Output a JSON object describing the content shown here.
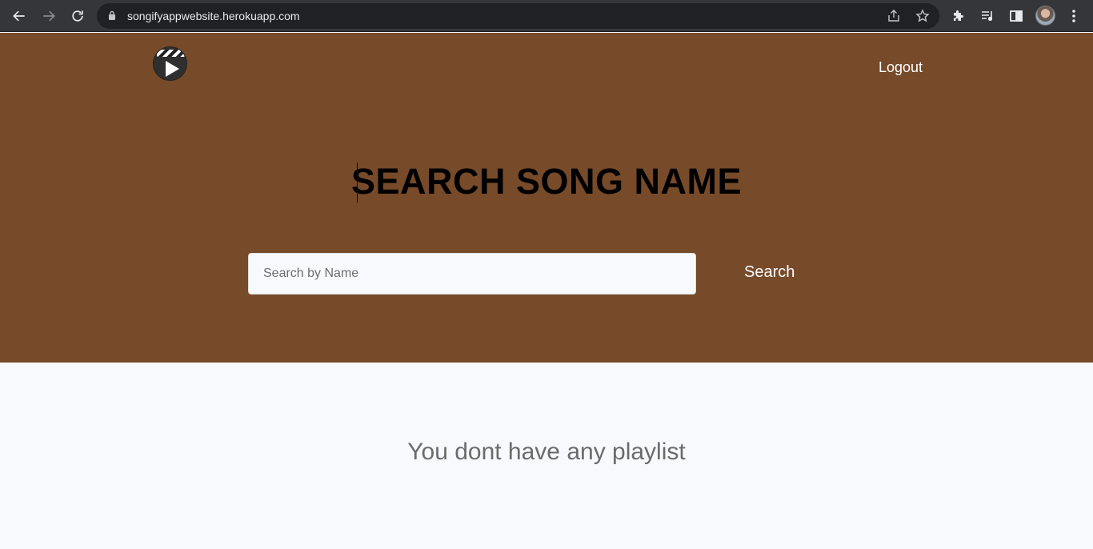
{
  "browser": {
    "url": "songifyappwebsite.herokuapp.com"
  },
  "header": {
    "logout_label": "Logout"
  },
  "hero": {
    "title_part1": "SEARCH ",
    "title_bold": "SONG",
    "title_part2": " NAME",
    "search_placeholder": "Search by Name",
    "search_value": "",
    "search_button_label": "Search"
  },
  "main": {
    "empty_message": "You dont have any playlist"
  },
  "colors": {
    "hero_background": "#774a29",
    "page_background": "#f8f9fd",
    "chrome_background": "#35363a"
  }
}
